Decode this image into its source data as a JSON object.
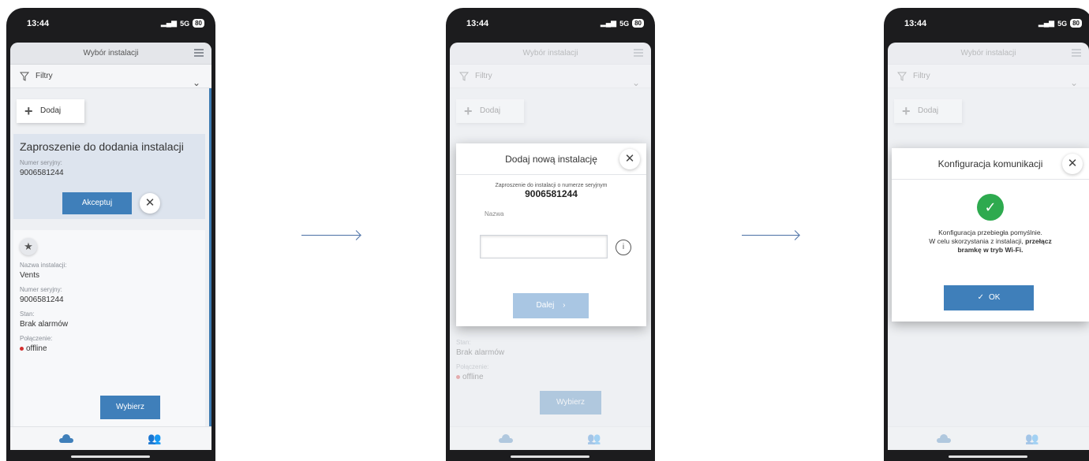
{
  "status": {
    "time": "13:44",
    "network": "5G",
    "battery": "80"
  },
  "header": {
    "title": "Wybór instalacji"
  },
  "filters": {
    "label": "Filtry"
  },
  "add": {
    "label": "Dodaj"
  },
  "invite": {
    "title": "Zaproszenie do dodania instalacji",
    "serial_label": "Numer seryjny:",
    "serial": "9006581244",
    "accept": "Akceptuj"
  },
  "installation": {
    "name_label": "Nazwa instalacji:",
    "name": "Vents",
    "serial_label": "Numer seryjny:",
    "serial": "9006581244",
    "state_label": "Stan:",
    "state": "Brak alarmów",
    "connection_label": "Połączenie:",
    "connection": "offline",
    "choose": "Wybierz"
  },
  "modal_add": {
    "title": "Dodaj nową instalację",
    "subtitle": "Zaproszenie do instalacji o numerze seryjnym",
    "serial": "9006581244",
    "name_label": "Nazwa",
    "name_value": "",
    "next": "Dalej"
  },
  "modal_config": {
    "title": "Konfiguracja komunikacji",
    "line1": "Konfiguracja przebiegła pomyślnie.",
    "line2": "W celu skorzystania z instalacji,",
    "bold1": "przełącz",
    "bold2": "bramkę w tryb Wi-Fi.",
    "ok": "OK"
  },
  "colors": {
    "accent": "#3f7fba",
    "success": "#2eaa4f",
    "offline": "#d32f2f"
  }
}
